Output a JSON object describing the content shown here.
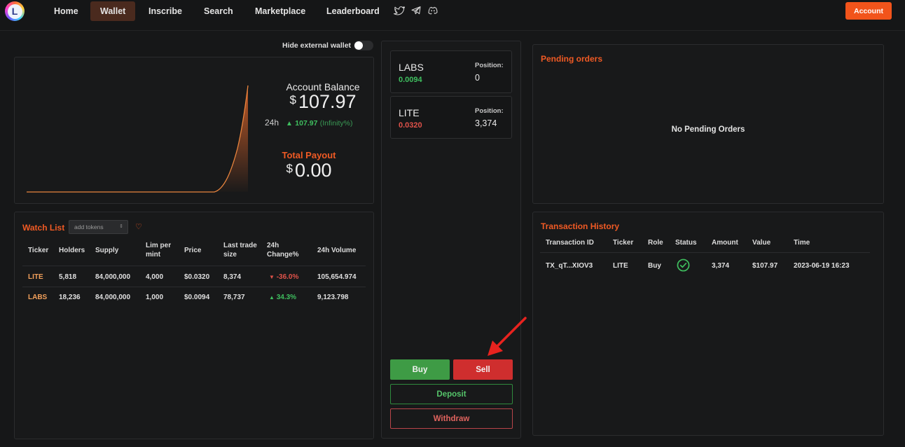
{
  "nav": {
    "logo_letter": "L",
    "items": [
      "Home",
      "Wallet",
      "Inscribe",
      "Search",
      "Marketplace",
      "Leaderboard"
    ],
    "active": "Wallet",
    "social_icons": [
      "twitter-icon",
      "telegram-icon",
      "discord-icon"
    ],
    "account_label": "Account"
  },
  "colors": {
    "accent": "#f05a24",
    "positive": "#3fbf5f",
    "negative": "#e0524a",
    "background": "#161718"
  },
  "wallet": {
    "hide_external_label": "Hide external wallet",
    "hide_external_on": false
  },
  "balance": {
    "title": "Account Balance",
    "currency": "$",
    "value": "107.97",
    "period": "24h",
    "change": "107.97",
    "change_pct": "(Infinity%)",
    "payout_title": "Total Payout",
    "payout_value": "0.00"
  },
  "watchlist": {
    "title": "Watch List",
    "select_placeholder": "add tokens",
    "headers": [
      "Ticker",
      "Holders",
      "Supply",
      "Lim per mint",
      "Price",
      "Last trade size",
      "24h Change%",
      "24h Volume"
    ],
    "rows": [
      {
        "ticker": "LITE",
        "holders": "5,818",
        "supply": "84,000,000",
        "lim": "4,000",
        "price": "$0.0320",
        "last": "8,374",
        "change": "-36.0%",
        "dir": "down",
        "volume": "105,654.974"
      },
      {
        "ticker": "LABS",
        "holders": "18,236",
        "supply": "84,000,000",
        "lim": "1,000",
        "price": "$0.0094",
        "last": "78,737",
        "change": "34.3%",
        "dir": "up",
        "volume": "9,123.798"
      }
    ]
  },
  "positions": [
    {
      "name": "LABS",
      "price": "0.0094",
      "dir": "up",
      "pos_label": "Position:",
      "pos_value": "0"
    },
    {
      "name": "LITE",
      "price": "0.0320",
      "dir": "down",
      "pos_label": "Position:",
      "pos_value": "3,374"
    }
  ],
  "actions": {
    "buy": "Buy",
    "sell": "Sell",
    "deposit": "Deposit",
    "withdraw": "Withdraw"
  },
  "pending": {
    "title": "Pending orders",
    "empty": "No Pending Orders"
  },
  "history": {
    "title": "Transaction History",
    "headers": [
      "Transaction ID",
      "Ticker",
      "Role",
      "Status",
      "Amount",
      "Value",
      "Time"
    ],
    "rows": [
      {
        "id": "TX_qT...XIOV3",
        "ticker": "LITE",
        "role": "Buy",
        "status": "success",
        "amount": "3,374",
        "value": "$107.97",
        "time": "2023-06-19 16:23"
      }
    ]
  }
}
